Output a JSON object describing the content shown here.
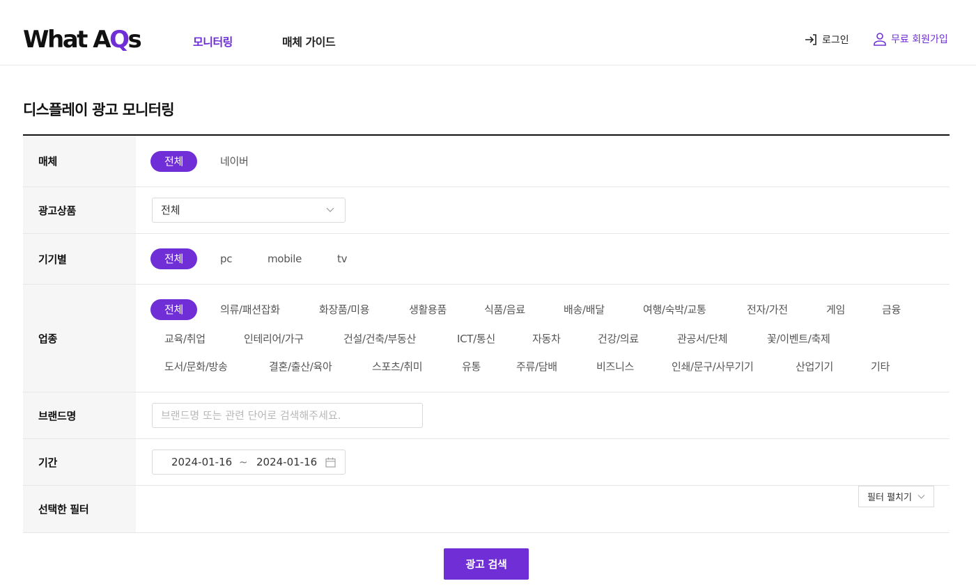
{
  "header": {
    "logo": {
      "text_main": "What A",
      "text_accent": "Q",
      "text_end": "s"
    },
    "nav": [
      {
        "label": "모니터링",
        "active": true
      },
      {
        "label": "매체 가이드",
        "active": false
      }
    ],
    "login_label": "로그인",
    "signup_label": "무료 회원가입"
  },
  "page_title": "디스플레이 광고 모니터링",
  "filters": {
    "media": {
      "label": "매체",
      "options": [
        "전체",
        "네이버"
      ],
      "selected": "전체"
    },
    "ad_product": {
      "label": "광고상품",
      "value": "전체"
    },
    "device": {
      "label": "기기별",
      "options": [
        "전체",
        "pc",
        "mobile",
        "tv"
      ],
      "selected": "전체"
    },
    "industry": {
      "label": "업종",
      "options": [
        "전체",
        "의류/패션잡화",
        "화장품/미용",
        "생활용품",
        "식품/음료",
        "배송/배달",
        "여행/숙박/교통",
        "전자/가전",
        "게임",
        "금융",
        "교육/취업",
        "인테리어/가구",
        "건설/건축/부동산",
        "ICT/통신",
        "자동차",
        "건강/의료",
        "관공서/단체",
        "꽃/이벤트/축제",
        "도서/문화/방송",
        "결혼/출산/육아",
        "스포츠/취미",
        "유통",
        "주류/담배",
        "비즈니스",
        "인쇄/문구/사무기기",
        "산업기기",
        "기타"
      ],
      "selected": "전체"
    },
    "brand": {
      "label": "브랜드명",
      "placeholder": "브랜드명 또는 관련 단어로 검색해주세요."
    },
    "period": {
      "label": "기간",
      "start": "2024-01-16",
      "separator": "~",
      "end": "2024-01-16"
    },
    "selected_filters": {
      "label": "선택한 필터",
      "expand_label": "필터 펼치기"
    }
  },
  "search_button": "광고 검색",
  "colors": {
    "accent": "#6f2ed6",
    "label_bg": "#f6f6f7",
    "border": "#e6e6e6"
  }
}
